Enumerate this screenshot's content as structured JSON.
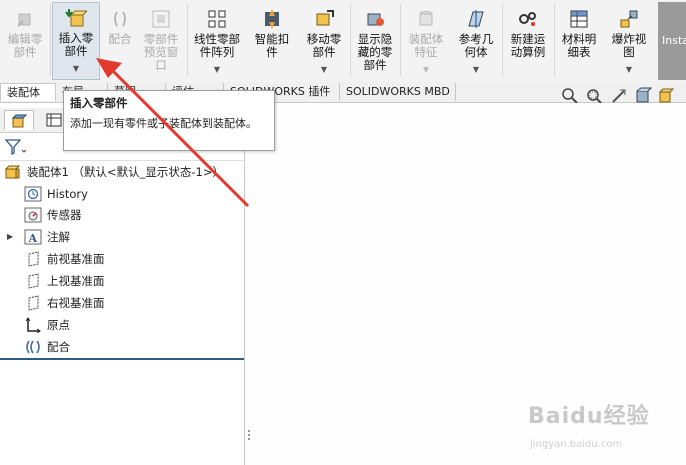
{
  "ribbon": {
    "buttons": [
      {
        "label": "编辑零\n部件",
        "icon": "edit-part-icon",
        "disabled": true
      },
      {
        "label": "插入零\n部件",
        "icon": "insert-component-icon",
        "active": true
      },
      {
        "label": "配合",
        "icon": "mate-icon",
        "disabled": true
      },
      {
        "label": "零部件\n预览窗\n口",
        "icon": "component-preview-icon",
        "disabled": true
      },
      {
        "label": "线性零部\n件阵列",
        "icon": "linear-pattern-icon"
      },
      {
        "label": "智能扣\n件",
        "icon": "smart-fastener-icon"
      },
      {
        "label": "移动零\n部件",
        "icon": "move-component-icon"
      },
      {
        "label": "显示隐\n藏的零\n部件",
        "icon": "show-hidden-icon"
      },
      {
        "label": "装配体\n特征",
        "icon": "assembly-feature-icon",
        "disabled": true
      },
      {
        "label": "参考几\n何体",
        "icon": "reference-geometry-icon"
      },
      {
        "label": "新建运\n动算例",
        "icon": "motion-study-icon"
      },
      {
        "label": "材料明\n细表",
        "icon": "bom-icon"
      },
      {
        "label": "爆炸视\n图",
        "icon": "exploded-view-icon"
      }
    ],
    "insta_label": "Insta"
  },
  "tabs": [
    "装配体",
    "布局",
    "草图",
    "评估",
    "SOLIDWORKS 插件",
    "SOLIDWORKS MBD"
  ],
  "tooltip": {
    "title": "插入零部件",
    "description": "添加一现有零件或子装配体到装配体。"
  },
  "tree": {
    "root": "装配体1 （默认<默认_显示状态-1>）",
    "items": [
      {
        "label": "History",
        "icon": "history-icon"
      },
      {
        "label": "传感器",
        "icon": "sensor-icon"
      },
      {
        "label": "注解",
        "icon": "annotation-icon",
        "expandable": true
      },
      {
        "label": "前视基准面",
        "icon": "plane-icon"
      },
      {
        "label": "上视基准面",
        "icon": "plane-icon"
      },
      {
        "label": "右视基准面",
        "icon": "plane-icon"
      },
      {
        "label": "原点",
        "icon": "origin-icon"
      },
      {
        "label": "配合",
        "icon": "mates-folder-icon"
      }
    ]
  },
  "watermark": {
    "brand": "Baidu经验",
    "url": "jingyan.baidu.com"
  },
  "colors": {
    "arrow": "#e23b2e",
    "accent": "#2f5a86"
  }
}
